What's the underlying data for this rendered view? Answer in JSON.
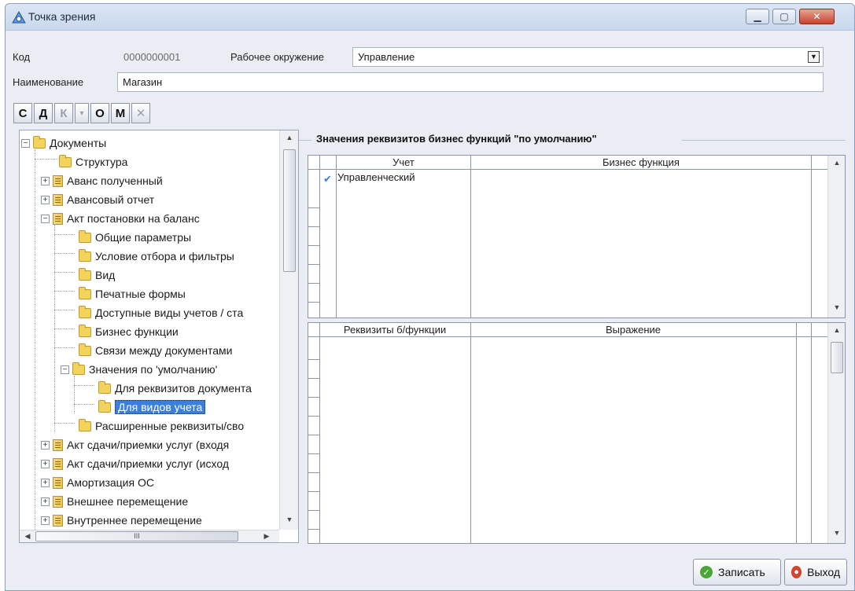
{
  "window": {
    "title": "Точка зрения",
    "controls": [
      "minimize",
      "maximize",
      "close"
    ]
  },
  "form": {
    "code_label": "Код",
    "code_value": "0000000001",
    "env_label": "Рабочее окружение",
    "env_value": "Управление",
    "name_label": "Наименование",
    "name_value": "Магазин"
  },
  "toolbar": {
    "buttons": [
      "С",
      "Д",
      "К",
      "▾",
      "О",
      "М",
      "✕"
    ]
  },
  "tree": {
    "items": [
      {
        "label": "Документы"
      },
      {
        "label": "Структура"
      },
      {
        "label": "Аванс полученный"
      },
      {
        "label": "Авансовый отчет"
      },
      {
        "label": "Акт постановки на баланс"
      },
      {
        "label": "Общие параметры"
      },
      {
        "label": "Условие отбора и фильтры"
      },
      {
        "label": "Вид"
      },
      {
        "label": "Печатные формы"
      },
      {
        "label": "Доступные виды учетов / ста"
      },
      {
        "label": "Бизнес функции"
      },
      {
        "label": "Связи между документами"
      },
      {
        "label": "Значения по 'умолчанию'"
      },
      {
        "label": "Для реквизитов документа"
      },
      {
        "label": "Для видов учета"
      },
      {
        "label": "Расширенные реквизиты/сво"
      },
      {
        "label": "Акт сдачи/приемки услуг (входя"
      },
      {
        "label": "Акт сдачи/приемки услуг (исход"
      },
      {
        "label": "Амортизация ОС"
      },
      {
        "label": "Внешнее перемещение"
      },
      {
        "label": "Внутреннее перемещение"
      }
    ],
    "selected": "Для видов учета",
    "hscroll_grip": "III"
  },
  "defaults_group": {
    "title": "Значения реквизитов бизнес функций \"по умолчанию\"",
    "top_grid": {
      "columns": [
        "Учет",
        "Бизнес функция"
      ],
      "rows": [
        {
          "checked": true,
          "account": "Управленческий",
          "function": ""
        }
      ]
    },
    "bottom_grid": {
      "columns": [
        "Реквизиты б/функции",
        "Выражение"
      ],
      "rows": []
    }
  },
  "buttons": {
    "save": "Записать",
    "exit": "Выход"
  },
  "colors": {
    "accent": "#3a7fdb",
    "save_icon": "#4aa63a",
    "exit_icon": "#d2442f"
  }
}
